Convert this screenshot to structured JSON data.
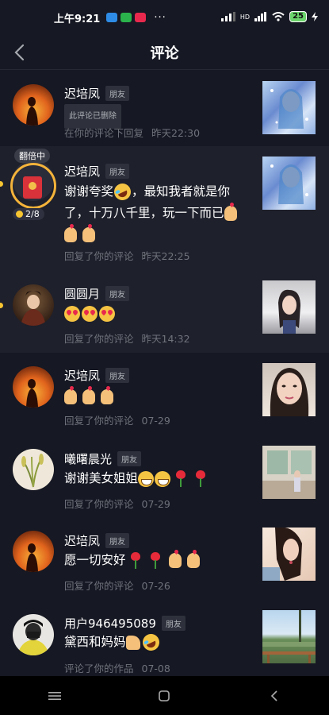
{
  "status_bar": {
    "time": "上午9:21",
    "dots": "···",
    "network": "HD",
    "battery": "25"
  },
  "nav": {
    "title": "评论"
  },
  "special_badges": {
    "fanbei": "翻倍中",
    "coins": "2/8"
  },
  "items": [
    {
      "name": "迟培凤",
      "tag": "朋友",
      "deleted_label": "此评论已删除",
      "action": "在你的评论下回复",
      "time": "昨天22:30",
      "avatar": "sunset-silhouette",
      "thumb": "sparkle-portrait"
    },
    {
      "name": "迟培凤",
      "tag": "朋友",
      "text": "谢谢夸奖",
      "text2": "，最知我者就是你了，十万八千里，玩一下而已",
      "action": "回复了你的评论",
      "time": "昨天22:25",
      "avatar": "redpacket-avatar",
      "thumb": "sparkle-portrait"
    },
    {
      "name": "圆圆月",
      "tag": "朋友",
      "action": "回复了你的评论",
      "time": "昨天14:32",
      "avatar": "costume-portrait",
      "thumb": "woman-portrait"
    },
    {
      "name": "迟培凤",
      "tag": "朋友",
      "action": "回复了你的评论",
      "time": "07-29",
      "avatar": "sunset-silhouette",
      "thumb": "woman-selfie"
    },
    {
      "name": "曦曙晨光",
      "tag": "朋友",
      "text": "谢谢美女姐姐",
      "action": "回复了你的评论",
      "time": "07-29",
      "avatar": "plant-avatar",
      "thumb": "room-photo"
    },
    {
      "name": "迟培凤",
      "tag": "朋友",
      "text": "愿一切安好",
      "action": "回复了你的评论",
      "time": "07-26",
      "avatar": "sunset-silhouette",
      "thumb": "woman-outdoor"
    },
    {
      "name": "用户946495089",
      "tag": "朋友",
      "text": "黛西和妈妈",
      "action": "评论了你的作品",
      "time": "07-08",
      "avatar": "masked-man",
      "thumb": "park-photo"
    }
  ],
  "colors": {
    "background": "#161823",
    "highlight_row": "#1e202b",
    "secondary_text": "#6f727b",
    "tag_bg": "#2e313b",
    "coin": "#f7c531"
  }
}
